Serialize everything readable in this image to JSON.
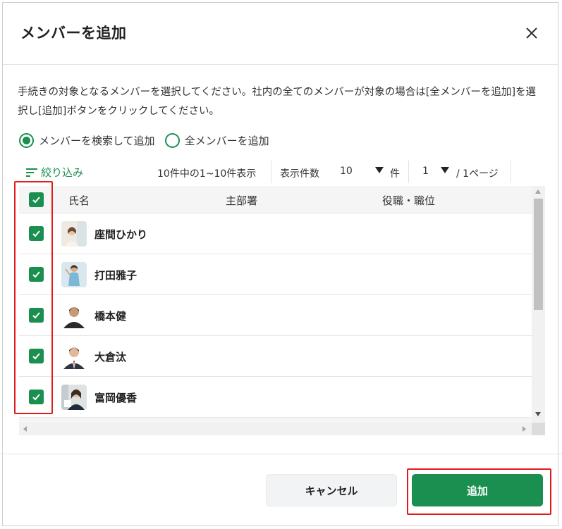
{
  "dialog": {
    "title": "メンバーを追加",
    "close_icon": "close-icon",
    "description": "手続きの対象となるメンバーを選択してください。社内の全てのメンバーが対象の場合は[全メンバーを追加]を選択し[追加]ボタンをクリックしてください。"
  },
  "mode": {
    "options": [
      {
        "label": "メンバーを検索して追加",
        "selected": true
      },
      {
        "label": "全メンバーを追加",
        "selected": false
      }
    ]
  },
  "toolbar": {
    "filter_label": "絞り込み",
    "filter_icon": "filter-lines-icon",
    "count_text": "10件中の1~10件表示",
    "per_page_label": "表示件数",
    "per_page_value": "10",
    "per_page_unit": "件",
    "page_value": "1",
    "page_total": "/ 1ページ"
  },
  "table": {
    "columns": [
      "氏名",
      "主部署",
      "役職・職位"
    ],
    "header_checked": true,
    "rows": [
      {
        "name": "座間ひかり",
        "checked": true,
        "avatar": "avatar-woman-light"
      },
      {
        "name": "打田雅子",
        "checked": true,
        "avatar": "avatar-woman-blue"
      },
      {
        "name": "橋本健",
        "checked": true,
        "avatar": "avatar-man-dark"
      },
      {
        "name": "大倉汰",
        "checked": true,
        "avatar": "avatar-man-suit"
      },
      {
        "name": "富岡優香",
        "checked": true,
        "avatar": "avatar-woman-office"
      }
    ]
  },
  "footer": {
    "cancel_label": "キャンセル",
    "add_label": "追加"
  },
  "colors": {
    "accent": "#1a8f4f",
    "highlight": "#e21b1b"
  }
}
